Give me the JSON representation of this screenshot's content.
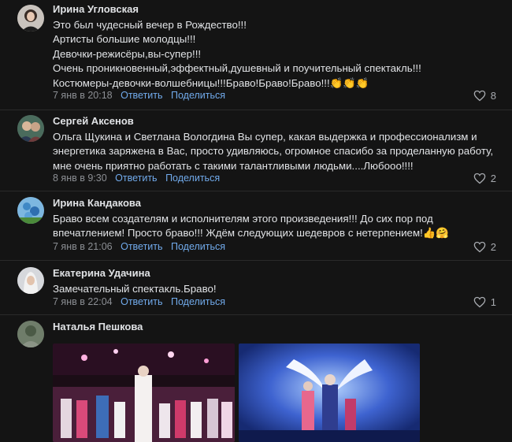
{
  "comments": [
    {
      "author": "Ирина Угловская",
      "lines": [
        "Это был чудесный вечер в Рождество!!!",
        "Артисты большие молодцы!!!",
        "Девочки-режисёры,вы-супер!!!",
        "Очень проникновенный,эффектный,душевный и поучительный спектакль!!!",
        "Костюмеры-девочки-волшебницы!!!Браво!Браво!Браво!!!👏👏👏"
      ],
      "date": "7 янв в 20:18",
      "reply": "Ответить",
      "share": "Поделиться",
      "likes": "8"
    },
    {
      "author": "Сергей Аксенов",
      "lines": [
        "Ольга Щукина и Светлана Вологдина Вы супер, какая выдержка и профессионализм и",
        "энергетика заряжена в Вас, просто удивляюсь, огромное спасибо за проделанную работу,",
        "мне очень приятно работать с такими талантливыми людьми....Любооо!!!!"
      ],
      "date": "8 янв в 9:30",
      "reply": "Ответить",
      "share": "Поделиться",
      "likes": "2"
    },
    {
      "author": "Ирина Кандакова",
      "lines": [
        "Браво всем создателям и исполнителям этого произведения!!! До сих пор под",
        "впечатлением! Просто браво!!! Ждём следующих шедевров с нетерпением!👍🤗"
      ],
      "date": "7 янв в 21:06",
      "reply": "Ответить",
      "share": "Поделиться",
      "likes": "2"
    },
    {
      "author": "Екатерина Удачина",
      "lines": [
        "Замечательный спектакль.Браво!"
      ],
      "date": "7 янв в 22:04",
      "reply": "Ответить",
      "share": "Поделиться",
      "likes": "1"
    },
    {
      "author": "Наталья Пешкова",
      "lines": [],
      "date": "",
      "reply": "",
      "share": "",
      "likes": ""
    }
  ],
  "colors": {
    "background": "#141414",
    "link": "#71aaeb",
    "meta": "#8c8f94",
    "text": "#e1e3e6"
  },
  "icons": {
    "like": "heart-outline-icon"
  }
}
